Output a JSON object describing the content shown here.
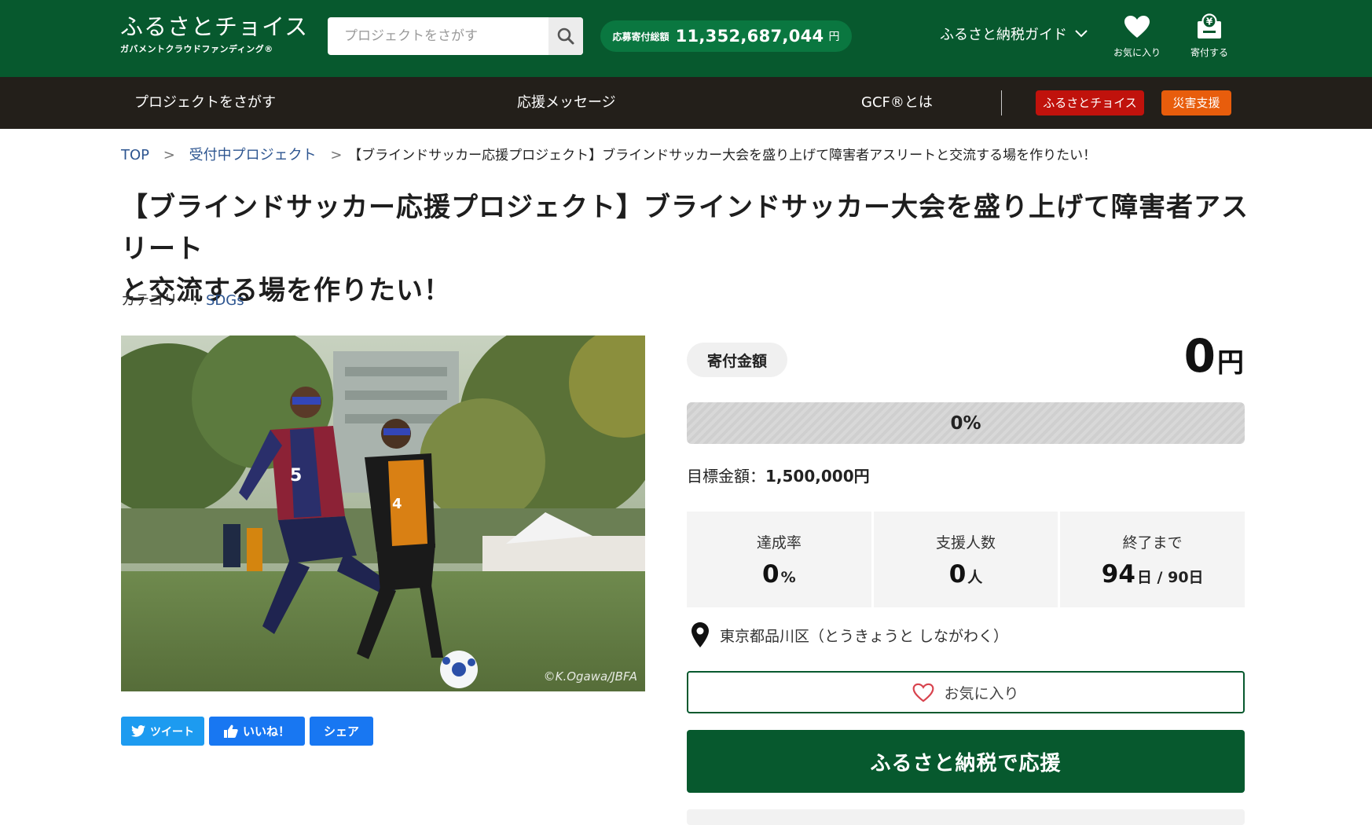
{
  "header": {
    "logo_title": "ふるさとチョイス",
    "logo_subtitle": "ガバメントクラウドファンディング®",
    "search_placeholder": "プロジェクトをさがす",
    "total_label": "応募寄付総額",
    "total_value": "11,352,687,044",
    "total_unit": "円",
    "guide_label": "ふるさと納税ガイド",
    "favorites_label": "お気に入り",
    "donate_label": "寄付する"
  },
  "nav": {
    "items": [
      "プロジェクトをさがす",
      "応援メッセージ",
      "GCF®とは"
    ],
    "choice_button": "ふるさとチョイス",
    "disaster_button": "災害支援"
  },
  "breadcrumb": {
    "top": "TOP",
    "projects": "受付中プロジェクト",
    "current": "【ブラインドサッカー応援プロジェクト】ブラインドサッカー大会を盛り上げて障害者アスリートと交流する場を作りたい！",
    "separator": ">"
  },
  "project": {
    "title_line1": "【ブラインドサッカー応援プロジェクト】ブラインドサッカー大会を盛り上げて障害者アスリート",
    "title_line2": "と交流する場を作りたい！",
    "category_label": "カテゴリー：",
    "category_value": "SDGs",
    "photo_credit": "©K.Ogawa/JBFA"
  },
  "social": {
    "tweet": "ツイート",
    "like": "いいね！",
    "share": "シェア"
  },
  "donation": {
    "amount_label": "寄付金額",
    "amount_value": "0",
    "amount_unit": "円",
    "progress_percent": 0,
    "progress_text": "0%",
    "goal_label": "目標金額：",
    "goal_value": "1,500,000円",
    "stats": {
      "rate_label": "達成率",
      "rate_value": "0",
      "rate_unit": "%",
      "supporters_label": "支援人数",
      "supporters_value": "0",
      "supporters_unit": "人",
      "remaining_label": "終了まで",
      "remaining_value": "94",
      "remaining_unit": "日 / 90日"
    },
    "location": "東京都品川区（とうきょうと しながわく）",
    "favorite_button": "お気に入り",
    "donate_button": "ふるさと納税で応援"
  },
  "colors": {
    "header_green": "#07592e",
    "nav_dark": "#231f1a",
    "accent_green": "#0a7740",
    "choice_red": "#c0120c",
    "disaster_orange": "#e85d0c",
    "twitter_blue": "#1d9bf0",
    "facebook_blue": "#1877f2",
    "link_blue": "#2d5590"
  }
}
